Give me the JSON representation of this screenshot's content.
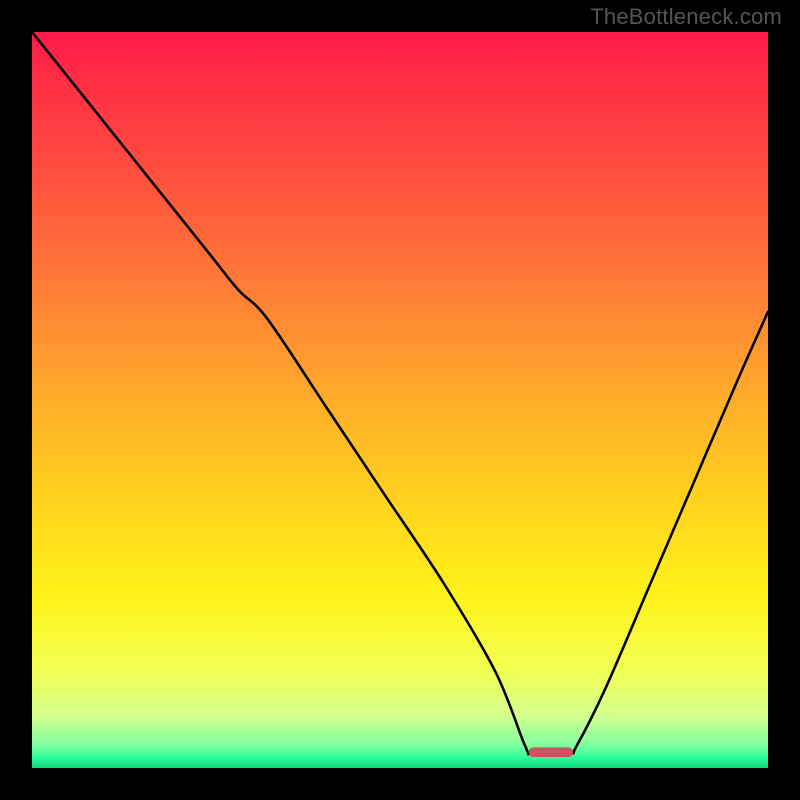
{
  "watermark": "TheBottleneck.com",
  "chart_data": {
    "type": "line",
    "title": "",
    "xlabel": "",
    "ylabel": "",
    "xlim": [
      0,
      100
    ],
    "ylim": [
      0,
      100
    ],
    "curve": {
      "name": "bottleneck-curve",
      "x": [
        0,
        8,
        16,
        24,
        28,
        32,
        40,
        48,
        56,
        63,
        67,
        68,
        73,
        74,
        78,
        84,
        90,
        96,
        100
      ],
      "y": [
        100,
        90,
        80,
        70,
        65,
        61,
        49,
        37,
        25,
        13,
        3,
        2,
        2,
        3,
        11,
        25,
        39,
        53,
        62
      ]
    },
    "min_marker": {
      "x_range": [
        67.5,
        73.5
      ],
      "y": 2,
      "color": "#c9565f"
    },
    "gradient_stops": [
      {
        "offset": 0.0,
        "color": "#ff1b48"
      },
      {
        "offset": 0.18,
        "color": "#ff4b3f"
      },
      {
        "offset": 0.34,
        "color": "#ff7a37"
      },
      {
        "offset": 0.5,
        "color": "#ffad2a"
      },
      {
        "offset": 0.64,
        "color": "#ffd31d"
      },
      {
        "offset": 0.77,
        "color": "#fff319"
      },
      {
        "offset": 0.87,
        "color": "#f1ff55"
      },
      {
        "offset": 0.93,
        "color": "#d3ff8f"
      },
      {
        "offset": 0.97,
        "color": "#7dffa0"
      },
      {
        "offset": 0.985,
        "color": "#2dff9e"
      },
      {
        "offset": 1.0,
        "color": "#0ed877"
      }
    ]
  }
}
